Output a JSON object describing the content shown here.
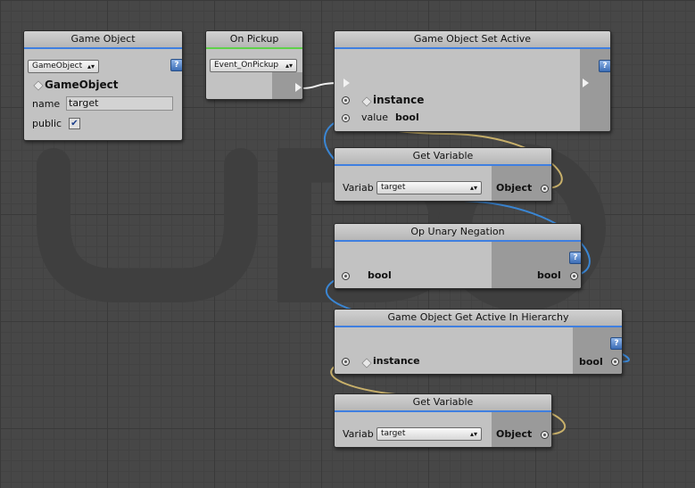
{
  "wire_colors": {
    "flow": "#f0f0f0",
    "bool": "#3a86d4",
    "object": "#c8b06a"
  },
  "header_accent": "#3f7fe0",
  "event_accent": "#5fd14a",
  "icons": {
    "help": "help-book-icon",
    "object": "cube-icon",
    "flow": "flow-arrow-icon"
  },
  "nodes": {
    "game_object": {
      "title": "Game Object",
      "type_dropdown": "GameObject",
      "type_name": "GameObject",
      "name_label": "name",
      "name_value": "target",
      "public_label": "public",
      "public_checked": true
    },
    "on_pickup": {
      "title": "On Pickup",
      "event_dropdown": "Event_OnPickup"
    },
    "set_active": {
      "title": "Game Object Set Active",
      "instance_label": "instance",
      "value_label": "value",
      "value_type": "bool"
    },
    "get_variable_1": {
      "title": "Get Variable",
      "var_label": "Variab",
      "var_dropdown": "target",
      "output_label": "Object"
    },
    "negation": {
      "title": "Op Unary Negation",
      "input_label": "bool",
      "output_label": "bool"
    },
    "get_active_hierarchy": {
      "title": "Game Object Get Active In Hierarchy",
      "instance_label": "instance",
      "output_label": "bool"
    },
    "get_variable_2": {
      "title": "Get Variable",
      "var_label": "Variab",
      "var_dropdown": "target",
      "output_label": "Object"
    }
  }
}
